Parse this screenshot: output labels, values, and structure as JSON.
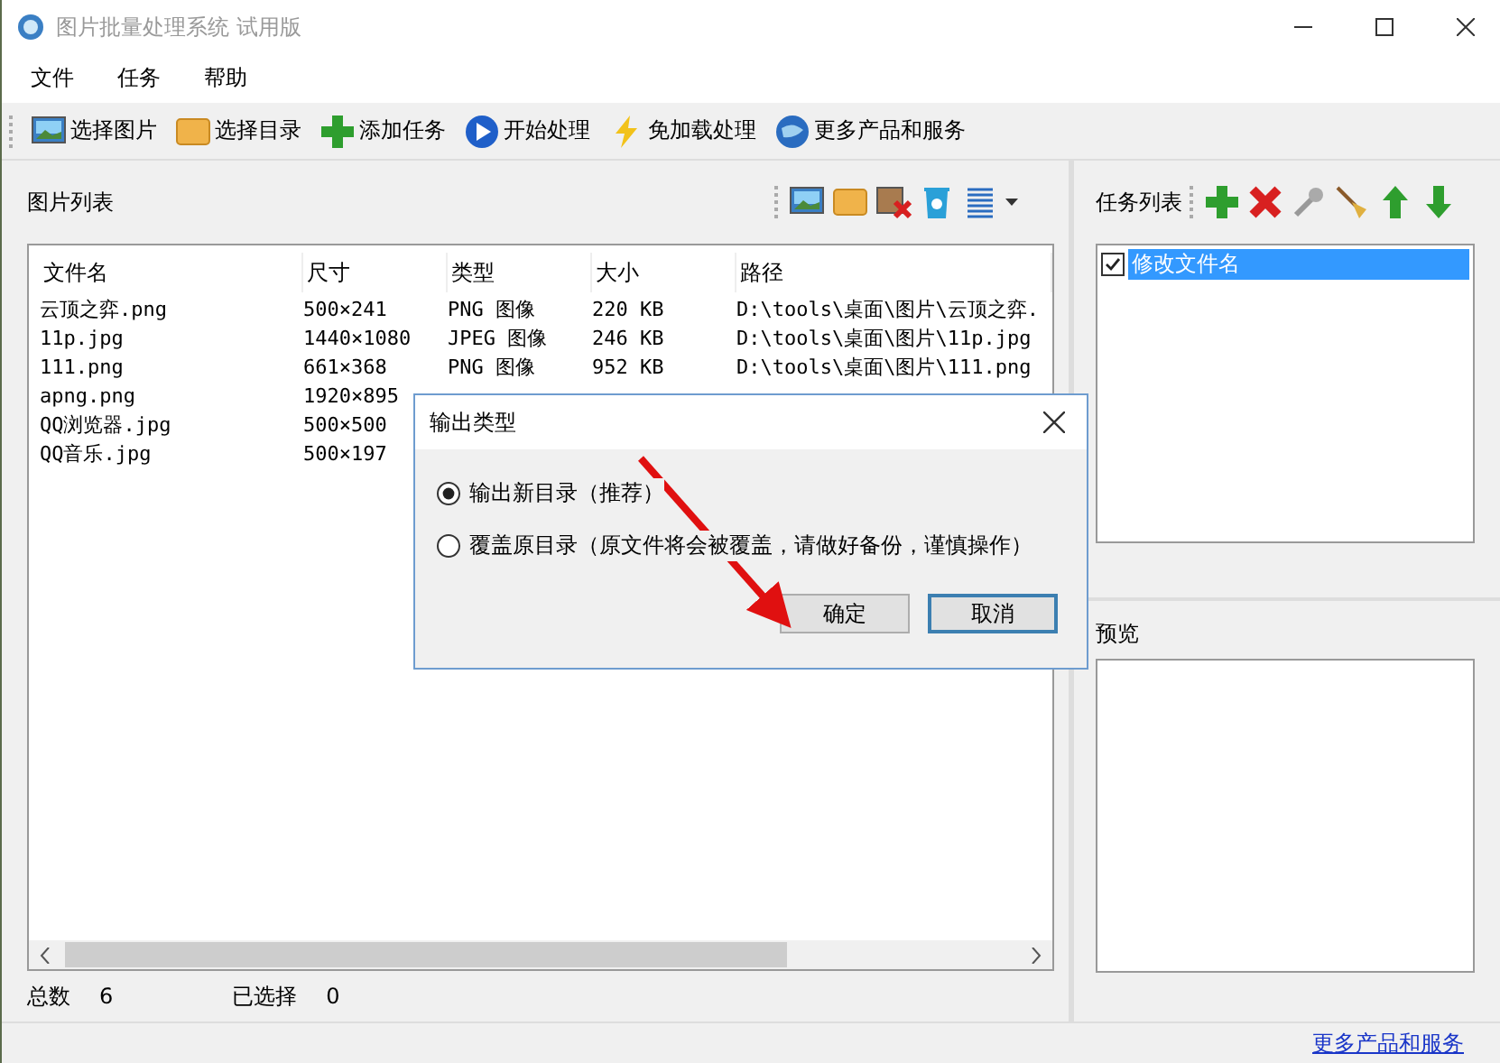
{
  "window": {
    "title": "图片批量处理系统 试用版"
  },
  "menu": [
    "文件",
    "任务",
    "帮助"
  ],
  "toolbar": [
    "选择图片",
    "选择目录",
    "添加任务",
    "开始处理",
    "免加载处理",
    "更多产品和服务"
  ],
  "image_list": {
    "title": "图片列表",
    "columns": [
      "文件名",
      "尺寸",
      "类型",
      "大小",
      "路径"
    ],
    "rows": [
      {
        "cells": [
          "云顶之弈.png",
          "500×241",
          "PNG 图像",
          "220 KB",
          "D:\\tools\\桌面\\图片\\云顶之弈."
        ]
      },
      {
        "cells": [
          "11p.jpg",
          "1440×1080",
          "JPEG 图像",
          "246 KB",
          "D:\\tools\\桌面\\图片\\11p.jpg"
        ]
      },
      {
        "cells": [
          "111.png",
          "661×368",
          "PNG 图像",
          "952 KB",
          "D:\\tools\\桌面\\图片\\111.png"
        ]
      },
      {
        "cells": [
          "apng.png",
          "1920×895"
        ]
      },
      {
        "cells": [
          "QQ浏览器.jpg",
          "500×500"
        ]
      },
      {
        "cells": [
          "QQ音乐.jpg",
          "500×197"
        ]
      }
    ],
    "total_label": "总数",
    "total": "6",
    "selected_label": "已选择",
    "selected_count": "0"
  },
  "task_list": {
    "title": "任务列表",
    "items": [
      {
        "label": "修改文件名",
        "checked": true,
        "selected": true
      }
    ]
  },
  "preview": {
    "title": "预览"
  },
  "footer_link": "更多产品和服务",
  "dialog": {
    "title": "输出类型",
    "options": [
      {
        "label": "输出新目录（推荐）",
        "selected": true
      },
      {
        "label": "覆盖原目录（原文件将会被覆盖，请做好备份，谨慎操作）",
        "selected": false
      }
    ],
    "buttons": [
      "确定",
      "取消"
    ]
  }
}
